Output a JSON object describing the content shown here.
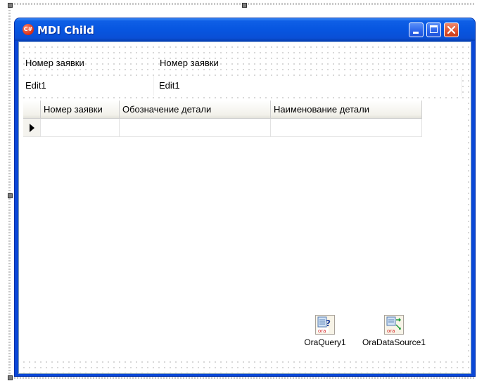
{
  "window": {
    "title": "MDI Child",
    "controls": {
      "minimize": "minimize",
      "maximize": "maximize",
      "close": "close"
    }
  },
  "form": {
    "label1": "Номер заявки",
    "label2": "Номер заявки",
    "edit1_value": "Edit1",
    "edit2_value": "Edit1"
  },
  "grid": {
    "columns": [
      "Номер заявки",
      "Обозначение детали",
      "Наименование детали"
    ],
    "rows": [
      [
        "",
        "",
        ""
      ]
    ]
  },
  "components": [
    {
      "name": "OraQuery1",
      "icon": "ora-query-icon"
    },
    {
      "name": "OraDataSource1",
      "icon": "ora-datasource-icon"
    }
  ],
  "colors": {
    "titlebar": "#0756e0",
    "close_button": "#e0512d"
  }
}
